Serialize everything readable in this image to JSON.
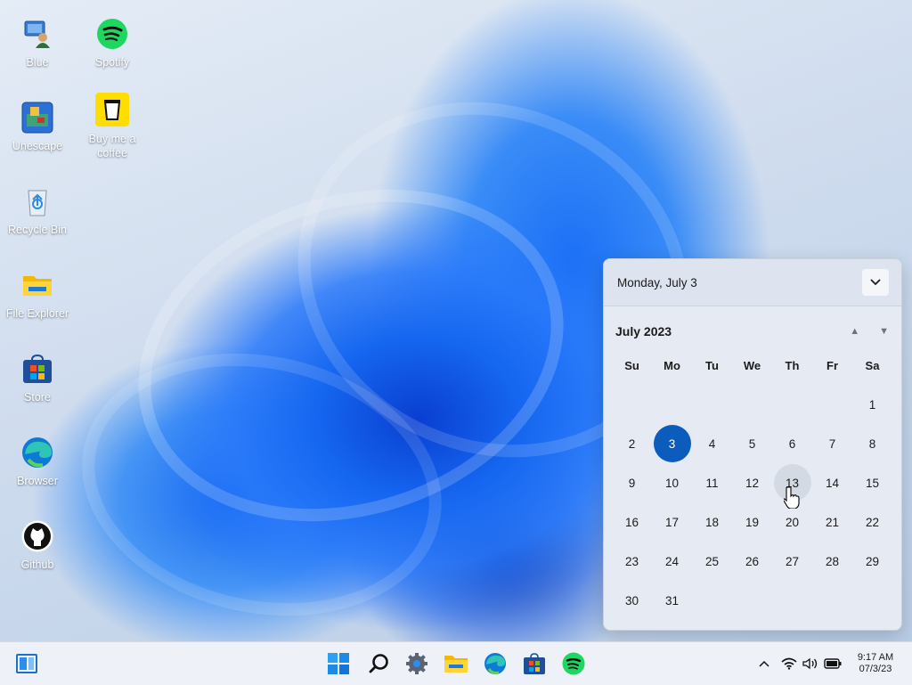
{
  "desktop": {
    "icons": [
      {
        "label": "Blue",
        "icon": "user-pc-icon"
      },
      {
        "label": "Spotify",
        "icon": "spotify-icon"
      },
      {
        "label": "Unescape",
        "icon": "unescape-icon"
      },
      {
        "label": "Buy me a coffee",
        "icon": "coffee-cup-icon"
      },
      {
        "label": "Recycle Bin",
        "icon": "recycle-bin-icon"
      },
      {
        "label": "File Explorer",
        "icon": "folder-icon"
      },
      {
        "label": "Store",
        "icon": "store-icon"
      },
      {
        "label": "Browser",
        "icon": "edge-icon"
      },
      {
        "label": "Github",
        "icon": "github-icon"
      }
    ]
  },
  "calendar": {
    "header_date": "Monday, July 3",
    "month_label": "July 2023",
    "weekdays": [
      "Su",
      "Mo",
      "Tu",
      "We",
      "Th",
      "Fr",
      "Sa"
    ],
    "days": [
      "",
      "",
      "",
      "",
      "",
      "",
      "1",
      "2",
      "3",
      "4",
      "5",
      "6",
      "7",
      "8",
      "9",
      "10",
      "11",
      "12",
      "13",
      "14",
      "15",
      "16",
      "17",
      "18",
      "19",
      "20",
      "21",
      "22",
      "23",
      "24",
      "25",
      "26",
      "27",
      "28",
      "29",
      "30",
      "31",
      "",
      "",
      "",
      "",
      ""
    ],
    "today": "3",
    "hovered": "13",
    "accent_color": "#0b5cbd"
  },
  "taskbar": {
    "pinned": [
      "widgets-icon",
      "start-icon",
      "search-icon",
      "settings-icon",
      "file-explorer-icon",
      "edge-icon",
      "store-icon",
      "spotify-icon"
    ],
    "tray": [
      "chevron-up-icon",
      "wifi-icon",
      "volume-icon",
      "battery-icon"
    ],
    "time": "9:17 AM",
    "date": "07/3/23"
  }
}
